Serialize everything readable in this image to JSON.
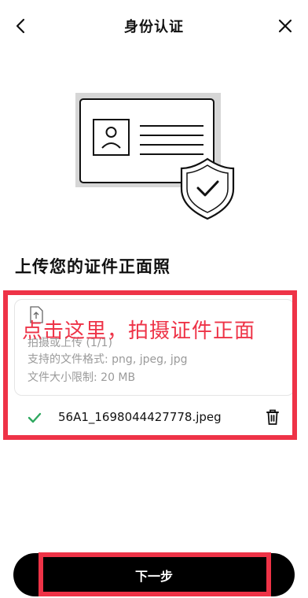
{
  "header": {
    "title": "身份认证"
  },
  "section": {
    "title": "上传您的证件正面照"
  },
  "upload": {
    "line1": "拍摄或上传 (1/1)",
    "line2": "支持的文件格式: png, jpeg, jpg",
    "line3": "文件大小限制: 20 MB"
  },
  "annotation": {
    "text": "点击这里，拍摄证件正面"
  },
  "file": {
    "name": "56A1_1698044427778.jpeg"
  },
  "footer": {
    "next_label": "下一步"
  },
  "colors": {
    "accent_red": "#ee3347",
    "success_green": "#2ea85f",
    "button_black": "#000000"
  }
}
